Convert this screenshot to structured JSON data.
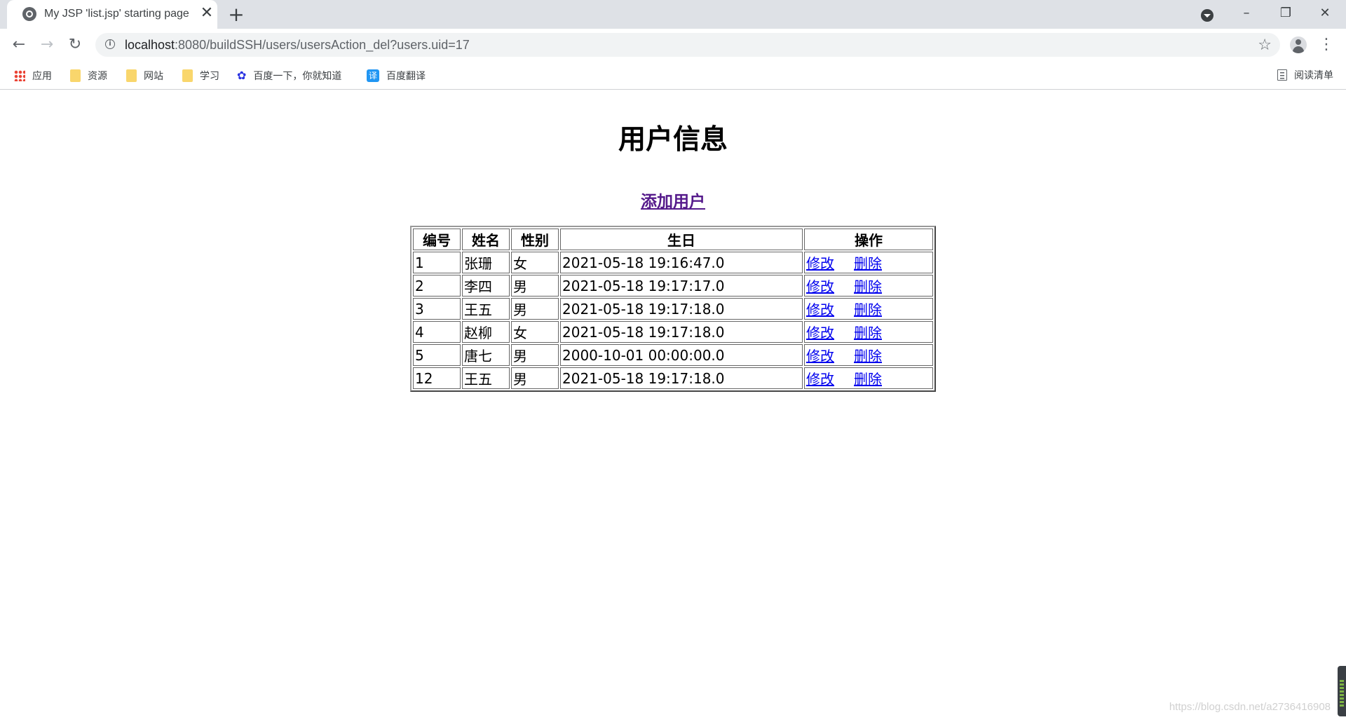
{
  "browser": {
    "tab_title": "My JSP 'list.jsp' starting page",
    "tab_close_glyph": "✕",
    "new_tab_glyph": "+",
    "url_host": "localhost",
    "url_rest": ":8080/buildSSH/users/usersAction_del?users.uid=17",
    "window_controls": [
      "–",
      "❐",
      "✕"
    ],
    "bookmarks": [
      {
        "label": "应用",
        "icon": "apps-grid-icon"
      },
      {
        "label": "资源",
        "icon": "folder-icon"
      },
      {
        "label": "网站",
        "icon": "folder-icon"
      },
      {
        "label": "学习",
        "icon": "folder-icon"
      },
      {
        "label": "百度一下，你就知道",
        "icon": "baidu-paw-icon"
      },
      {
        "label": "百度翻译",
        "icon": "baidu-translate-icon",
        "icon_text": "译"
      }
    ],
    "reading_list": "阅读清单"
  },
  "page": {
    "title": "用户信息",
    "add_user_link": "添加用户",
    "table": {
      "headers": [
        "编号",
        "姓名",
        "性别",
        "生日",
        "操作"
      ],
      "rows": [
        {
          "id": "1",
          "name": "张珊",
          "gender": "女",
          "birthday": "2021-05-18 19:16:47.0",
          "edit": "修改",
          "delete": "删除"
        },
        {
          "id": "2",
          "name": "李四",
          "gender": "男",
          "birthday": "2021-05-18 19:17:17.0",
          "edit": "修改",
          "delete": "删除"
        },
        {
          "id": "3",
          "name": "王五",
          "gender": "男",
          "birthday": "2021-05-18 19:17:18.0",
          "edit": "修改",
          "delete": "删除"
        },
        {
          "id": "4",
          "name": "赵柳",
          "gender": "女",
          "birthday": "2021-05-18 19:17:18.0",
          "edit": "修改",
          "delete": "删除"
        },
        {
          "id": "5",
          "name": "唐七",
          "gender": "男",
          "birthday": "2000-10-01 00:00:00.0",
          "edit": "修改",
          "delete": "删除"
        },
        {
          "id": "12",
          "name": "王五",
          "gender": "男",
          "birthday": "2021-05-18 19:17:18.0",
          "edit": "修改",
          "delete": "删除"
        }
      ]
    },
    "watermark": "https://blog.csdn.net/a2736416908"
  },
  "colors": {
    "tabstrip_bg": "#dee1e6",
    "visited_link": "#551a8b",
    "link": "#0000ee"
  }
}
